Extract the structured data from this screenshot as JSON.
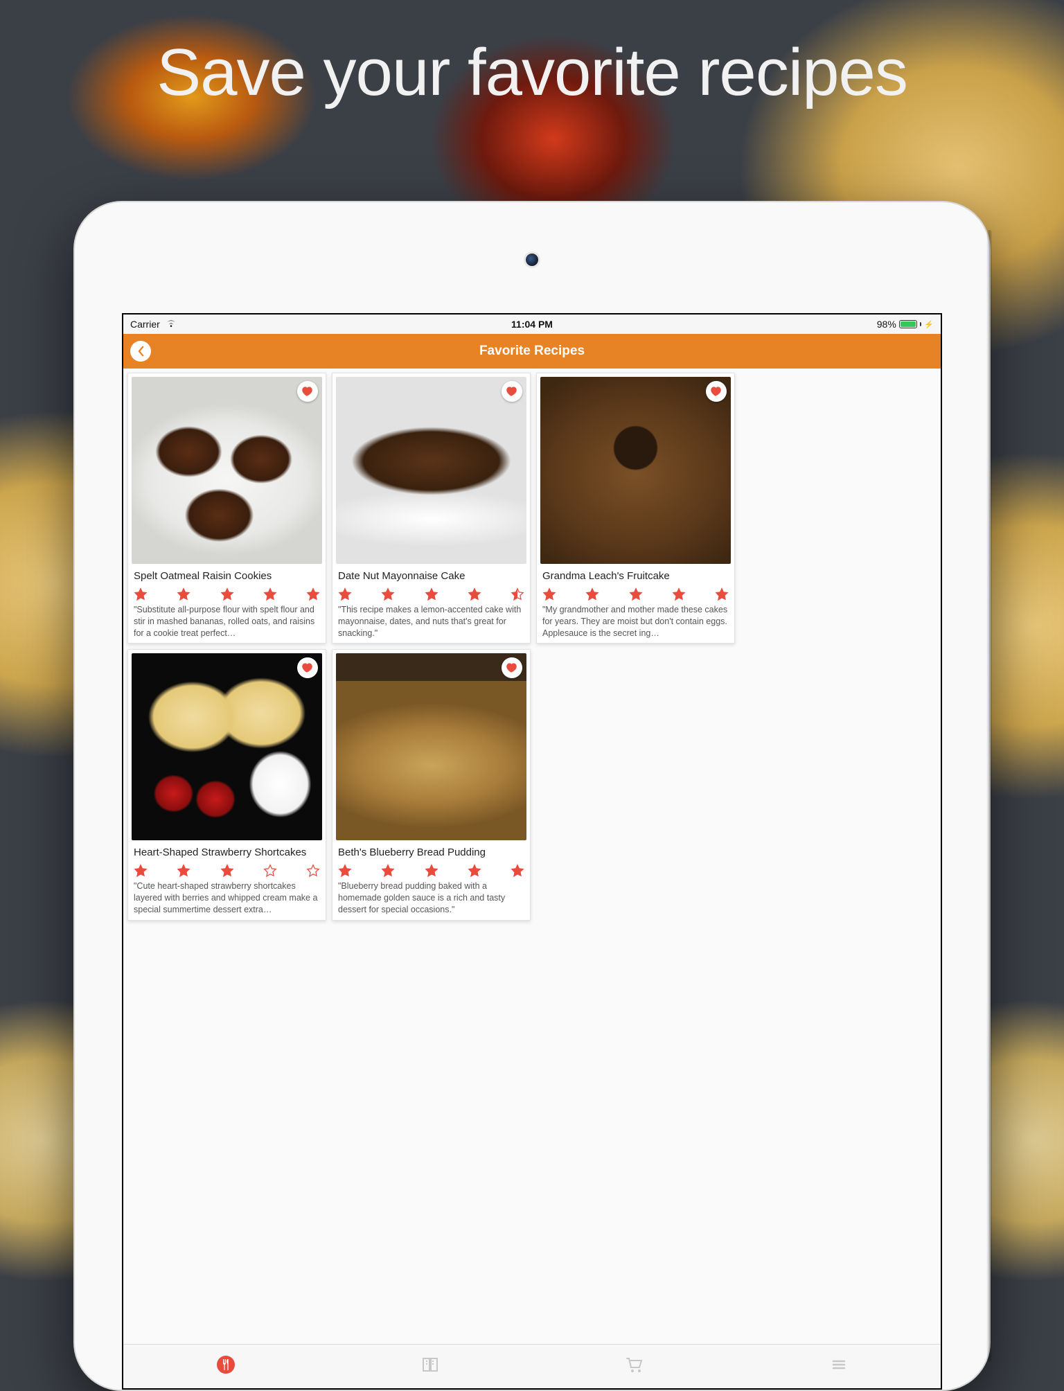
{
  "promo_headline": "Save your favorite recipes",
  "statusbar": {
    "carrier": "Carrier",
    "time": "11:04 PM",
    "battery_pct": "98%",
    "battery_fill_pct": 98
  },
  "navbar": {
    "title": "Favorite Recipes"
  },
  "colors": {
    "accent": "#e78325",
    "heart": "#e94b3c",
    "star": "#e94b3c",
    "battery_fill": "#35c858"
  },
  "tabs": [
    {
      "name": "tab-recipes",
      "active": true
    },
    {
      "name": "tab-browse",
      "active": false
    },
    {
      "name": "tab-shopping",
      "active": false
    },
    {
      "name": "tab-more",
      "active": false
    }
  ],
  "recipes": [
    {
      "title": "Spelt Oatmeal Raisin Cookies",
      "desc": "\"Substitute all-purpose flour with spelt flour and stir in mashed bananas, rolled oats, and raisins for a cookie treat perfect…",
      "rating": 5,
      "img_class": "img-cookies"
    },
    {
      "title": "Date Nut Mayonnaise Cake",
      "desc": "\"This recipe makes a lemon-accented cake with mayonnaise, dates, and nuts that's great for snacking.\"",
      "rating": 4.5,
      "img_class": "img-cake"
    },
    {
      "title": "Grandma Leach's Fruitcake",
      "desc": "\"My grandmother and mother made these cakes for years. They are moist but don't contain eggs. Applesauce is the secret ing…",
      "rating": 5,
      "img_class": "img-fruitcake"
    },
    {
      "title": "Heart-Shaped Strawberry Shortcakes",
      "desc": "\"Cute heart-shaped strawberry shortcakes layered with berries and whipped cream make a special summertime dessert extra…",
      "rating": 3,
      "img_class": "img-shortcake"
    },
    {
      "title": "Beth's Blueberry Bread Pudding",
      "desc": "\"Blueberry bread pudding baked with a homemade golden sauce is a rich and tasty dessert for special occasions.\"",
      "rating": 5,
      "img_class": "img-bread"
    }
  ]
}
